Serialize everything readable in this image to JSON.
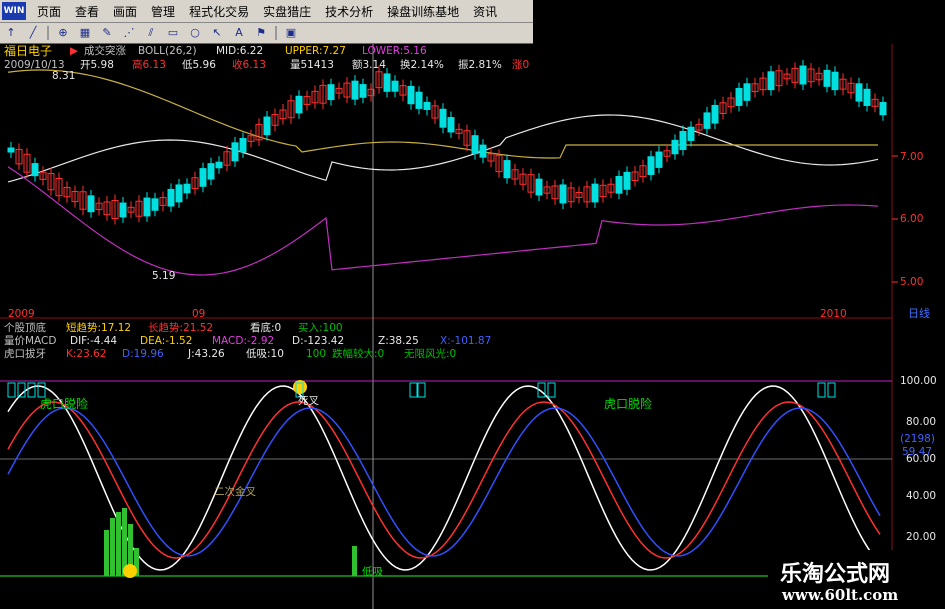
{
  "menu": {
    "logo": "WIN",
    "items": [
      "页面",
      "查看",
      "画面",
      "管理",
      "程式化交易",
      "实盘猎庄",
      "技术分析",
      "操盘训练基地",
      "资讯"
    ]
  },
  "toolbar": {
    "icons": [
      "arrow-up-icon",
      "line-icon",
      "zoom-icon",
      "grid-icon",
      "pen-icon",
      "fan-icon",
      "parallel-icon",
      "rect-icon",
      "circle-icon",
      "cursor-icon",
      "text-icon",
      "flag-icon",
      "save-icon"
    ]
  },
  "header": {
    "stock_name": "福日电子",
    "mode": "成交突涨",
    "indicator": "BOLL(26,2)",
    "mid": "MID:6.22",
    "upper": "UPPER:7.27",
    "lower": "LOWER:5.16",
    "date": "2009/10/13",
    "open": "开5.98",
    "high": "高6.13",
    "low": "低5.96",
    "close": "收6.13",
    "volume": "量51413",
    "amount": "额3.14",
    "turnover": "换2.14%",
    "amplitude": "振2.81%",
    "change": "涨0"
  },
  "price_chart": {
    "high_label": "8.31",
    "low_label": "5.19",
    "y_ticks": [
      "7.00",
      "6.00",
      "5.00"
    ],
    "x_labels": [
      "2009",
      "09",
      "2010"
    ],
    "period": "日线"
  },
  "indicators": {
    "line1_name": "个股顶底",
    "short_trend": "短趋势:17.12",
    "long_trend": "长趋势:21.52",
    "top_bottom": "看底:0",
    "buy_label": "买入:100",
    "line2_name": "量价MACD",
    "dif": "DIF:-4.44",
    "dea": "DEA:-1.52",
    "macd": "MACD:-2.92",
    "d_val": "D:-123.42",
    "z_val": "Z:38.25",
    "x_val": "X:-101.87",
    "line3_name": "虎口拔牙",
    "k_val": "K:23.62",
    "d2_val": "D:19.96",
    "j_val": "J:43.26",
    "low_absorb": "低吸:10",
    "low_absorb_val": "100",
    "drop_large": "跌幅较大:0",
    "no_limit": "无限风光:0"
  },
  "kdj_panel": {
    "annotations": {
      "tiger1": "虎口脱险",
      "tiger2": "虎口脱险",
      "dead_cross": "死叉",
      "golden_cross": "二次金叉",
      "low_label": "低吸"
    },
    "y_ticks": [
      "100.00",
      "80.00",
      "60.00",
      "40.00",
      "20.00"
    ],
    "readout_code": "(2198)",
    "readout_value": "59.47"
  },
  "watermark": {
    "line1": "乐淘公式网",
    "line2": "www.60lt.com"
  },
  "colors": {
    "up": "#ff3030",
    "down": "#00e0e0",
    "boll_upper": "#c8b040",
    "boll_mid": "#e8e8e8",
    "boll_lower": "#c030c0",
    "k_line": "#ff3030",
    "d_line": "#3050ff",
    "j_line": "#ffffff"
  }
}
